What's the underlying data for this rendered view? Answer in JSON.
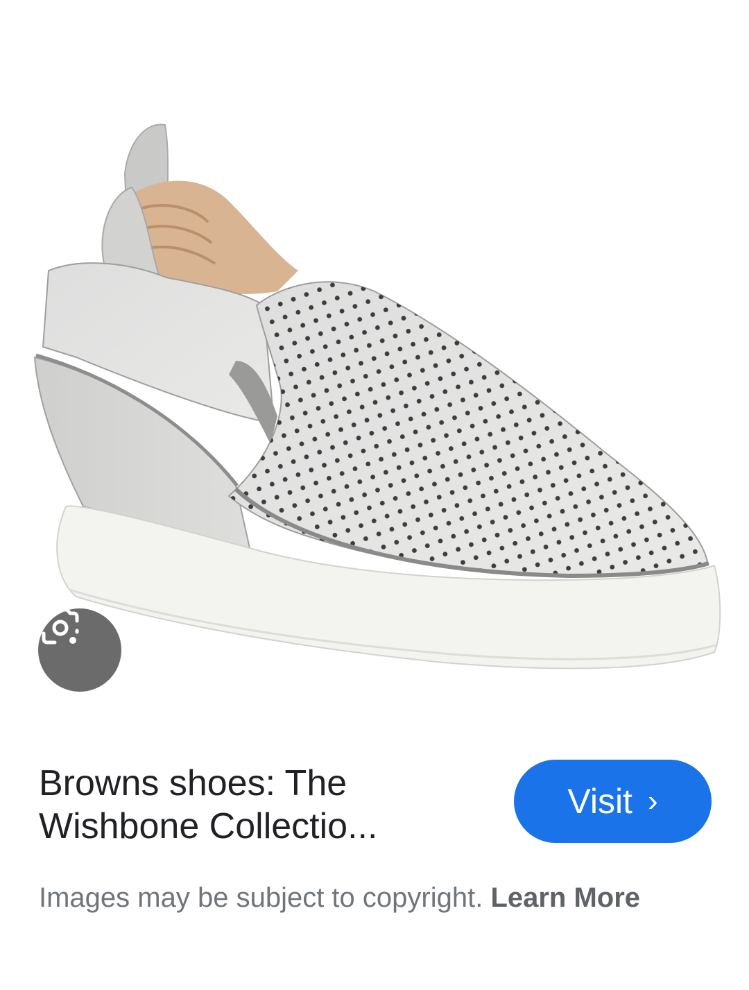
{
  "image": {
    "subject_icon": "shoe-image",
    "lens_icon": "google-lens-icon"
  },
  "result": {
    "title": "Browns shoes: The Wishbone Collectio...",
    "visit_label": "Visit",
    "visit_chevron": "›"
  },
  "copyright": {
    "notice": "Images may be subject to copyright.",
    "learn_more": "Learn More"
  },
  "colors": {
    "accent": "#1a73e8",
    "title": "#202124",
    "muted": "#70757a",
    "lens_button": "#6b6b6b"
  }
}
